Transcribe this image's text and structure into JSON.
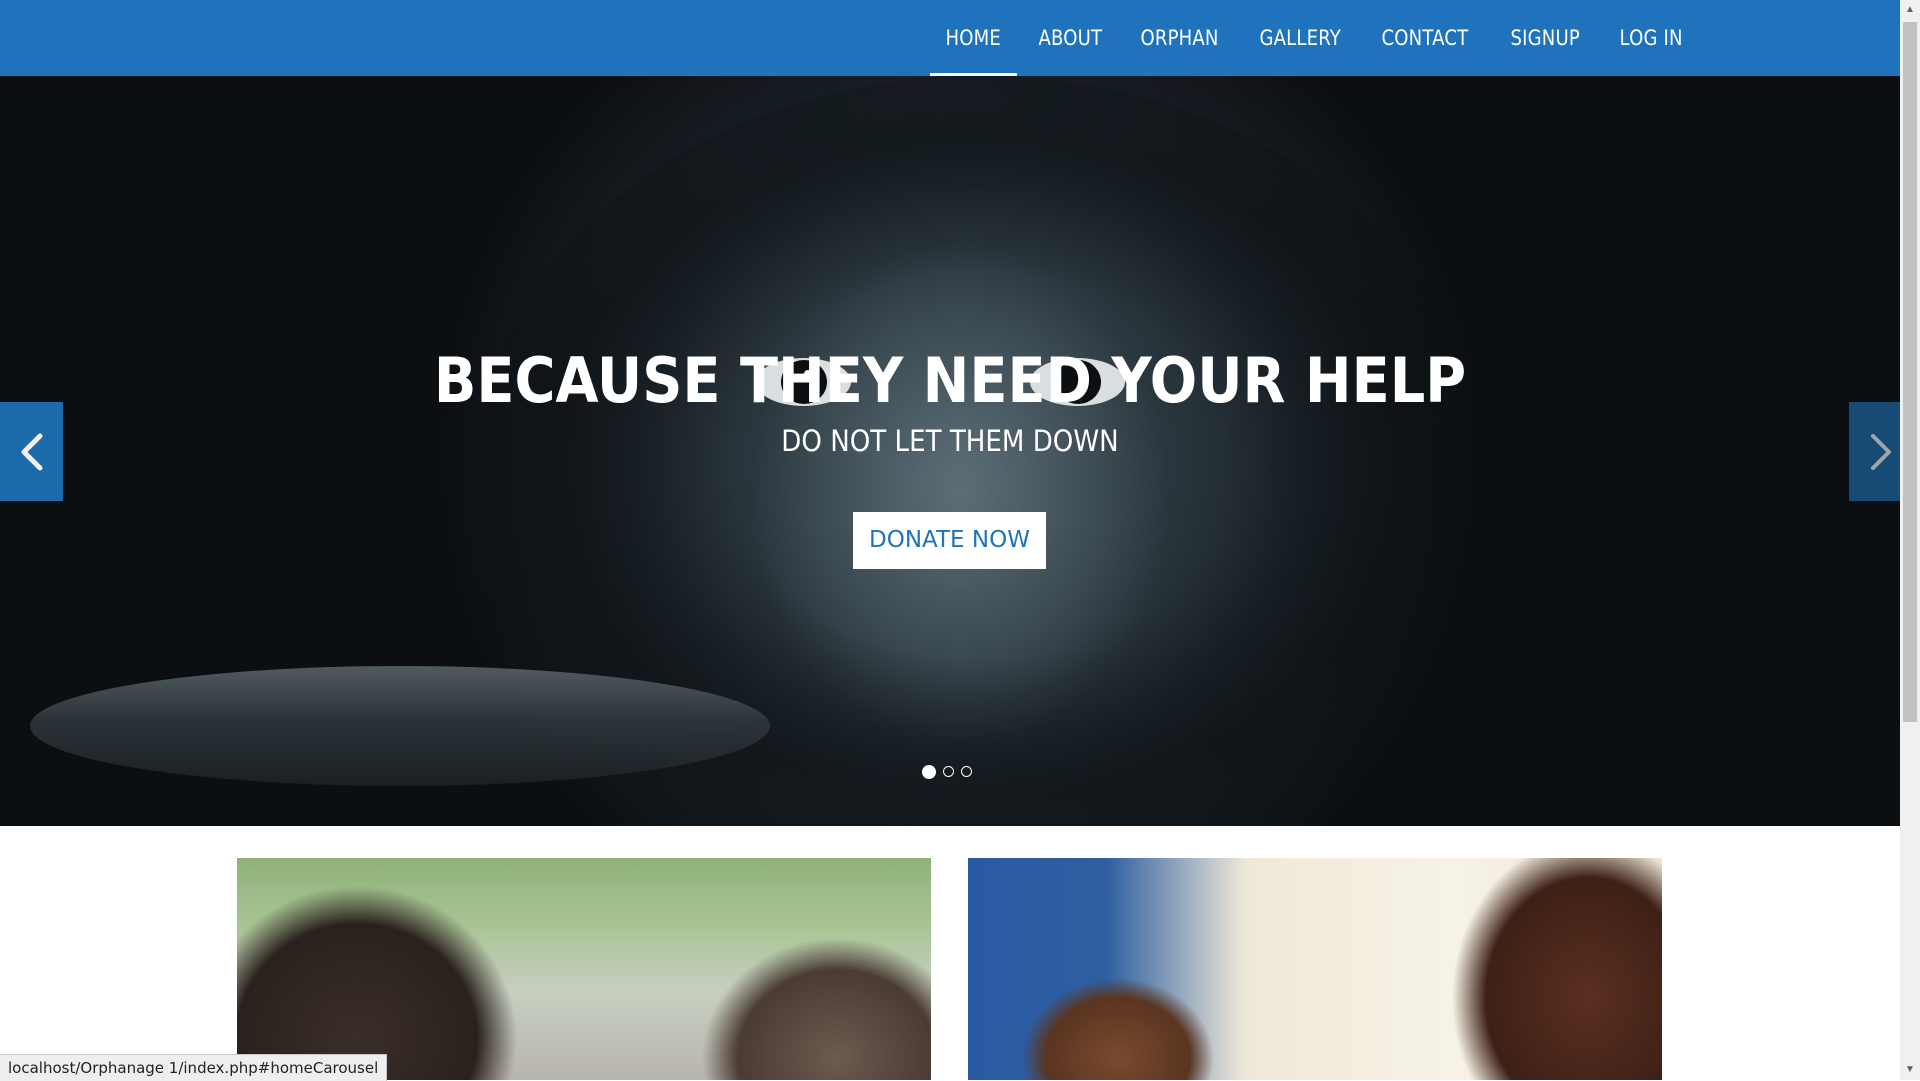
{
  "nav": {
    "items": [
      {
        "label": "HOME",
        "active": true
      },
      {
        "label": "ABOUT"
      },
      {
        "label": "ORPHAN"
      },
      {
        "label": "GALLERY"
      },
      {
        "label": "CONTACT"
      },
      {
        "label": "SIGNUP"
      },
      {
        "label": "LOG IN"
      }
    ]
  },
  "hero": {
    "title": "BECAUSE THEY NEED YOUR HELP",
    "subtitle": "DO NOT LET THEM DOWN",
    "button_label": "DONATE NOW",
    "prev_icon": "chevron-left-icon",
    "next_icon": "chevron-right-icon",
    "slide_count": 3,
    "active_slide": 1
  },
  "status_bar": {
    "url": "localhost/Orphanage 1/index.php#homeCarousel"
  },
  "colors": {
    "brand": "#1f73bd",
    "button_text": "#1f73bd"
  }
}
